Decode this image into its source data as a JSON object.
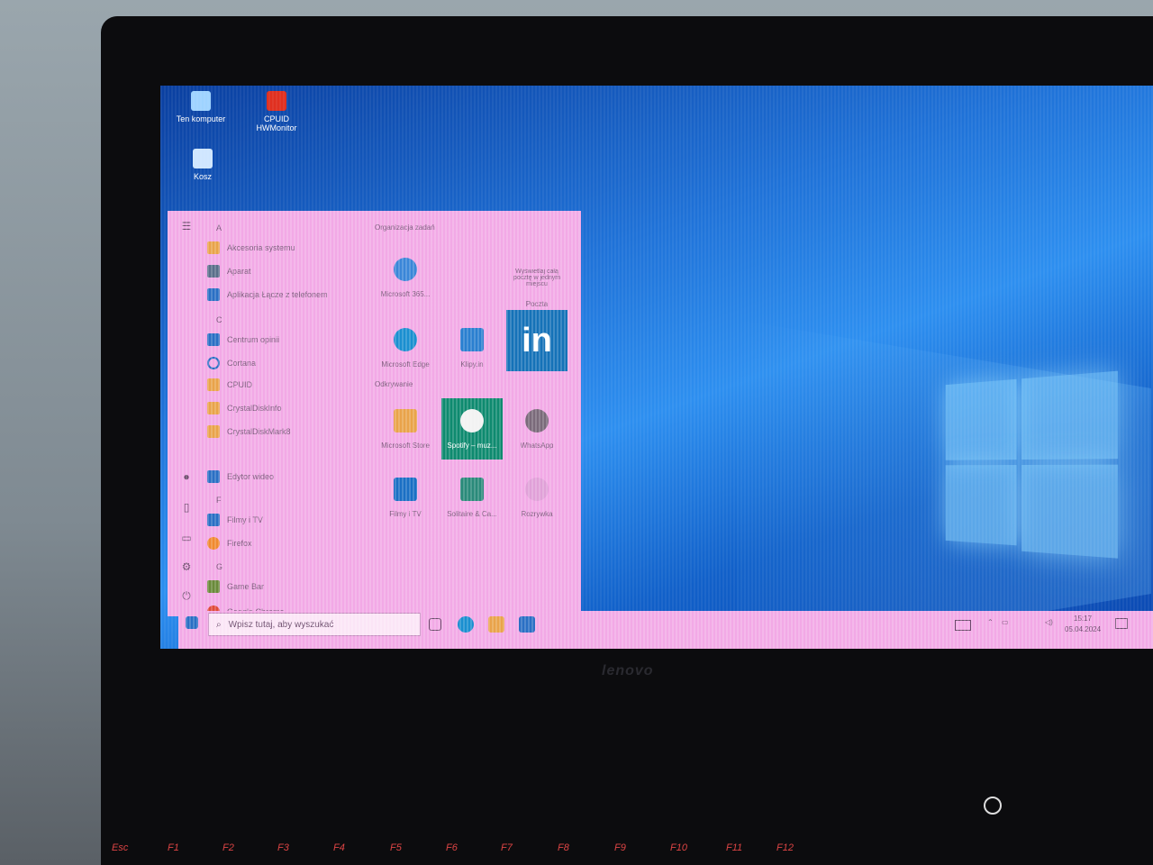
{
  "desktop": {
    "icons": [
      {
        "label": "Ten komputer",
        "icon": "computer-icon"
      },
      {
        "label": "CPUID HWMonitor",
        "icon": "hwmonitor-icon"
      },
      {
        "label": "Kosz",
        "icon": "recycle-bin-icon"
      }
    ]
  },
  "start_menu": {
    "section_header": "Organizacja zadań",
    "letters": [
      "A",
      "C",
      "F",
      "G"
    ],
    "apps": [
      {
        "label": "Akcesoria systemu",
        "icon": "folder-icon"
      },
      {
        "label": "Aparat",
        "icon": "camera-icon"
      },
      {
        "label": "Aplikacja Łącze z telefonem",
        "icon": "phone-link-icon"
      },
      {
        "label": "Centrum opinii",
        "icon": "feedback-icon"
      },
      {
        "label": "Cortana",
        "icon": "cortana-icon"
      },
      {
        "label": "CPUID",
        "icon": "folder-icon"
      },
      {
        "label": "CrystalDiskInfo",
        "icon": "folder-icon"
      },
      {
        "label": "CrystalDiskMark8",
        "icon": "folder-icon"
      },
      {
        "label": "Edytor wideo",
        "icon": "video-editor-icon"
      },
      {
        "label": "Filmy i TV",
        "icon": "films-tv-icon"
      },
      {
        "label": "Firefox",
        "icon": "firefox-icon"
      },
      {
        "label": "Game Bar",
        "icon": "game-bar-icon"
      },
      {
        "label": "Google Chrome",
        "icon": "chrome-icon"
      }
    ],
    "tiles": [
      {
        "label": "Microsoft 365...",
        "icon": "m365-icon"
      },
      {
        "label": "Wyświetlaj całą pocztę w jednym miejscu",
        "icon": "mail-icon"
      },
      {
        "label": "Poczta",
        "icon": "mail-icon"
      },
      {
        "label": "Microsoft Edge",
        "icon": "edge-icon"
      },
      {
        "label": "Klipy.in",
        "icon": "photos-icon"
      },
      {
        "label": "LinkedIn",
        "icon": "linkedin-icon"
      },
      {
        "label": "Odkrywanie",
        "icon": "discover-icon"
      },
      {
        "label": "Microsoft Store",
        "icon": "store-icon"
      },
      {
        "label": "Spotify – muz...",
        "icon": "spotify-icon"
      },
      {
        "label": "WhatsApp",
        "icon": "whatsapp-icon"
      },
      {
        "label": "Filmy i TV",
        "icon": "films-tv-icon"
      },
      {
        "label": "Solitaire & Ca...",
        "icon": "solitaire-icon"
      },
      {
        "label": "Rozrywka",
        "icon": "entertainment-icon"
      }
    ],
    "rail_icons": [
      "menu-icon",
      "user-icon",
      "document-icon",
      "pictures-icon",
      "settings-icon",
      "power-icon"
    ]
  },
  "taskbar": {
    "search_placeholder": "Wpisz tutaj, aby wyszukać",
    "time": "15:17",
    "date": "05.04.2024"
  },
  "brand": "lenovo",
  "keys": [
    "Esc",
    "F1",
    "F2",
    "F3",
    "F4",
    "F5",
    "F6",
    "F7",
    "F8",
    "F9",
    "F10",
    "F11",
    "F12"
  ],
  "colors": {
    "start_menu_bg": "#f2a9e6",
    "spotify_tile": "#0e8a6f",
    "linkedin_tile": "#1572b8",
    "wallpaper": "#1f72d8"
  }
}
